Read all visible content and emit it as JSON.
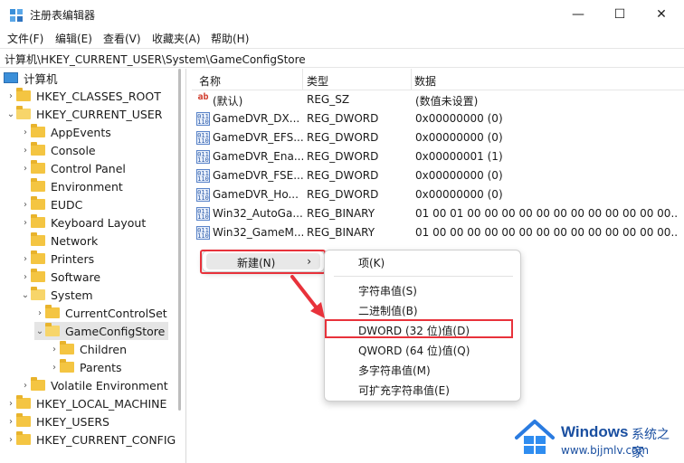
{
  "window": {
    "title": "注册表编辑器",
    "minimize_glyph": "—",
    "maximize_glyph": "☐",
    "close_glyph": "✕"
  },
  "menu": [
    "文件(F)",
    "编辑(E)",
    "查看(V)",
    "收藏夹(A)",
    "帮助(H)"
  ],
  "address": "计算机\\HKEY_CURRENT_USER\\System\\GameConfigStore",
  "tree": {
    "root": "计算机",
    "items": [
      {
        "label": "HKEY_CLASSES_ROOT",
        "expanded": false
      },
      {
        "label": "HKEY_CURRENT_USER",
        "expanded": true
      },
      {
        "label": "AppEvents",
        "expanded": false
      },
      {
        "label": "Console",
        "expanded": false
      },
      {
        "label": "Control Panel",
        "expanded": false
      },
      {
        "label": "Environment",
        "expanded": false
      },
      {
        "label": "EUDC",
        "expanded": false
      },
      {
        "label": "Keyboard Layout",
        "expanded": false
      },
      {
        "label": "Network",
        "expanded": false
      },
      {
        "label": "Printers",
        "expanded": false
      },
      {
        "label": "Software",
        "expanded": false
      },
      {
        "label": "System",
        "expanded": true
      },
      {
        "label": "CurrentControlSet",
        "expanded": false
      },
      {
        "label": "GameConfigStore",
        "expanded": true,
        "selected": true
      },
      {
        "label": "Children",
        "expanded": false
      },
      {
        "label": "Parents",
        "expanded": false
      },
      {
        "label": "Volatile Environment",
        "expanded": false
      },
      {
        "label": "HKEY_LOCAL_MACHINE",
        "expanded": false
      },
      {
        "label": "HKEY_USERS",
        "expanded": false
      },
      {
        "label": "HKEY_CURRENT_CONFIG",
        "expanded": false
      }
    ]
  },
  "list": {
    "headers": {
      "name": "名称",
      "type": "类型",
      "data": "数据"
    },
    "rows": [
      {
        "icon": "ab",
        "name": "(默认)",
        "type": "REG_SZ",
        "data": "(数值未设置)"
      },
      {
        "icon": "bin",
        "name": "GameDVR_DX...",
        "type": "REG_DWORD",
        "data": "0x00000000 (0)"
      },
      {
        "icon": "bin",
        "name": "GameDVR_EFS...",
        "type": "REG_DWORD",
        "data": "0x00000000 (0)"
      },
      {
        "icon": "bin",
        "name": "GameDVR_Ena...",
        "type": "REG_DWORD",
        "data": "0x00000001 (1)"
      },
      {
        "icon": "bin",
        "name": "GameDVR_FSE...",
        "type": "REG_DWORD",
        "data": "0x00000000 (0)"
      },
      {
        "icon": "bin",
        "name": "GameDVR_Ho...",
        "type": "REG_DWORD",
        "data": "0x00000000 (0)"
      },
      {
        "icon": "bin",
        "name": "Win32_AutoGa...",
        "type": "REG_BINARY",
        "data": "01 00 01 00 00 00 00 00 00 00 00 00 00 00 00..."
      },
      {
        "icon": "bin",
        "name": "Win32_GameM...",
        "type": "REG_BINARY",
        "data": "01 00 00 00 00 00 00 00 00 00 00 00 00 00 00..."
      }
    ],
    "icon_text": {
      "ab": "ab",
      "bin": "011 110"
    }
  },
  "context_menu": {
    "new_label": "新建(N)",
    "arrow": "›",
    "submenu": {
      "key": "项(K)",
      "string": "字符串值(S)",
      "binary": "二进制值(B)",
      "dword": "DWORD (32 位)值(D)",
      "qword": "QWORD (64 位)值(Q)",
      "multi_string": "多字符串值(M)",
      "expandable_string": "可扩充字符串值(E)"
    }
  },
  "watermark": {
    "title": "Windows",
    "title_cn": "系统之家",
    "url": "www.bjjmlv.com"
  },
  "colors": {
    "highlight_red": "#e8323b",
    "folder_yellow": "#f4c542",
    "selection_gray": "#e5e5e5",
    "brand_blue": "#1a4fa0"
  }
}
